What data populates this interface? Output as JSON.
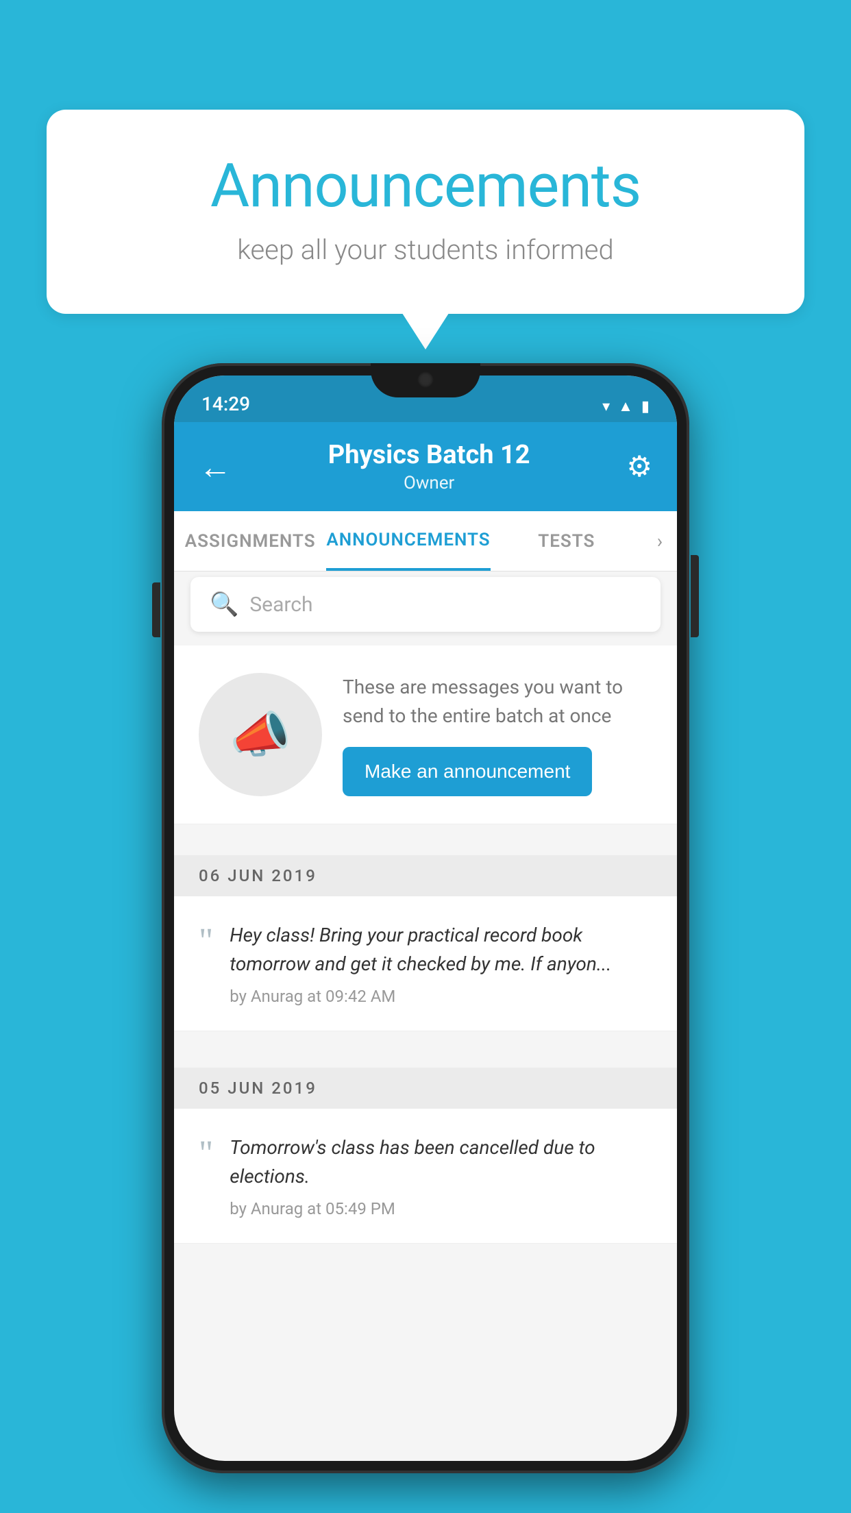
{
  "page": {
    "background_color": "#29b6d8"
  },
  "speech_bubble": {
    "title": "Announcements",
    "subtitle": "keep all your students informed"
  },
  "phone": {
    "status_bar": {
      "time": "14:29"
    },
    "header": {
      "title": "Physics Batch 12",
      "subtitle": "Owner",
      "back_label": "←",
      "settings_label": "⚙"
    },
    "tabs": [
      {
        "label": "ASSIGNMENTS",
        "active": false
      },
      {
        "label": "ANNOUNCEMENTS",
        "active": true
      },
      {
        "label": "TESTS",
        "active": false
      }
    ],
    "search": {
      "placeholder": "Search"
    },
    "promo": {
      "description": "These are messages you want to send to the entire batch at once",
      "button_label": "Make an announcement"
    },
    "date_dividers": [
      {
        "label": "06  JUN  2019"
      },
      {
        "label": "05  JUN  2019"
      }
    ],
    "announcements": [
      {
        "message": "Hey class! Bring your practical record book tomorrow and get it checked by me. If anyon...",
        "meta": "by Anurag at 09:42 AM"
      },
      {
        "message": "Tomorrow's class has been cancelled due to elections.",
        "meta": "by Anurag at 05:49 PM"
      }
    ]
  }
}
